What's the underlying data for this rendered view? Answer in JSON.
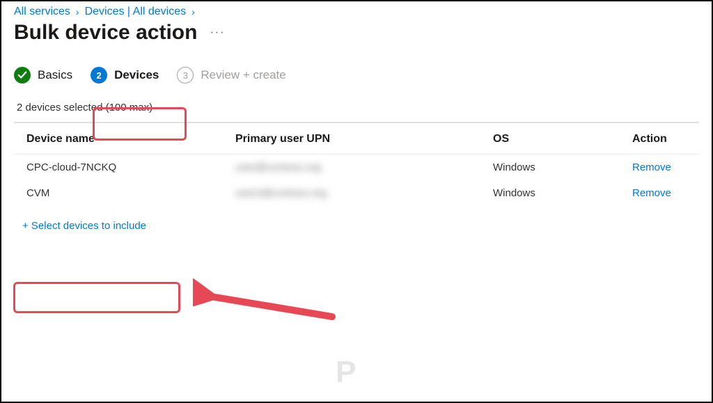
{
  "breadcrumb": {
    "item1": "All services",
    "item2": "Devices | All devices"
  },
  "page_title": "Bulk device action",
  "more_label": "…",
  "wizard": {
    "step1_label": "Basics",
    "step2_num": "2",
    "step2_label": "Devices",
    "step3_num": "3",
    "step3_label": "Review + create"
  },
  "selection_text": "2 devices selected (100 max)",
  "table": {
    "col_device": "Device name",
    "col_upn": "Primary user UPN",
    "col_os": "OS",
    "col_action": "Action",
    "rows": [
      {
        "device": "CPC-cloud-7NCKQ",
        "upn": "user@contoso.org",
        "os": "Windows",
        "action": "Remove"
      },
      {
        "device": "CVM",
        "upn": "user2@contoso.org",
        "os": "Windows",
        "action": "Remove"
      }
    ]
  },
  "add_link": "+ Select devices to include"
}
